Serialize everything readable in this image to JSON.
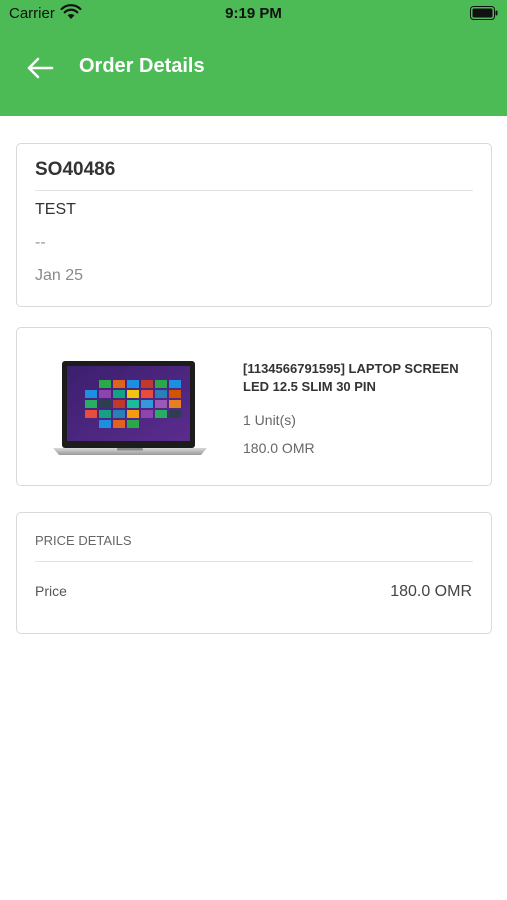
{
  "status_bar": {
    "carrier": "Carrier",
    "time": "9:19 PM",
    "icons": [
      "wifi-icon",
      "battery-icon"
    ]
  },
  "app_bar": {
    "title": "Order Details",
    "back_icon": "arrow-left-icon",
    "background_color": "#4cba55"
  },
  "order": {
    "number": "SO40486",
    "customer": "TEST",
    "note": "--",
    "date": "Jan 25"
  },
  "product": {
    "name": "[1134566791595] LAPTOP SCREEN LED 12.5 SLIM 30 PIN",
    "quantity": "1 Unit(s)",
    "price": "180.0 OMR",
    "image": "laptop-image"
  },
  "price_details": {
    "heading": "PRICE DETAILS",
    "price_label": "Price",
    "price_value": "180.0 OMR"
  }
}
